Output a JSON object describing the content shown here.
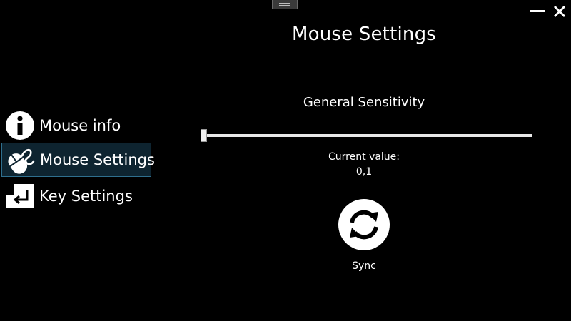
{
  "window": {
    "title": "Mouse Settings",
    "controls": {
      "minimize_icon": "minimize-icon",
      "close_icon": "close-icon"
    }
  },
  "sidebar": {
    "items": [
      {
        "label": "Mouse info",
        "icon": "info-icon",
        "active": false
      },
      {
        "label": "Mouse Settings",
        "icon": "mouse-icon",
        "active": true
      },
      {
        "label": "Key Settings",
        "icon": "enter-key-icon",
        "active": false
      }
    ]
  },
  "sensitivity": {
    "label": "General Sensitivity",
    "current_caption": "Current value:",
    "current_value": "0,1",
    "slider_fraction": 0.0
  },
  "sync": {
    "label": "Sync",
    "icon": "sync-icon"
  },
  "colors": {
    "background": "#000000",
    "text": "#ffffff",
    "active_item_bg": "#0e2430",
    "active_item_border": "#2f6f8e"
  }
}
